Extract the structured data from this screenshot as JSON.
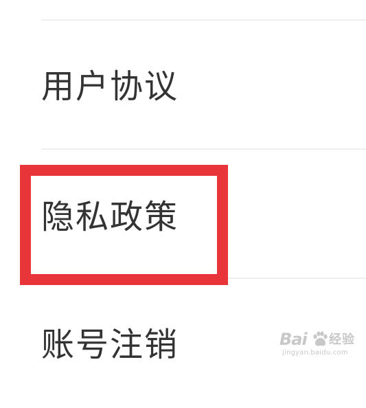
{
  "menu": {
    "items": [
      {
        "label": "用户协议"
      },
      {
        "label": "隐私政策"
      },
      {
        "label": "账号注销"
      }
    ]
  },
  "highlight": {
    "color": "#e8353a",
    "target": "隐私政策"
  },
  "watermark": {
    "brand": "Bai",
    "cn": "经验",
    "url": "jingyan.baidu.com"
  }
}
